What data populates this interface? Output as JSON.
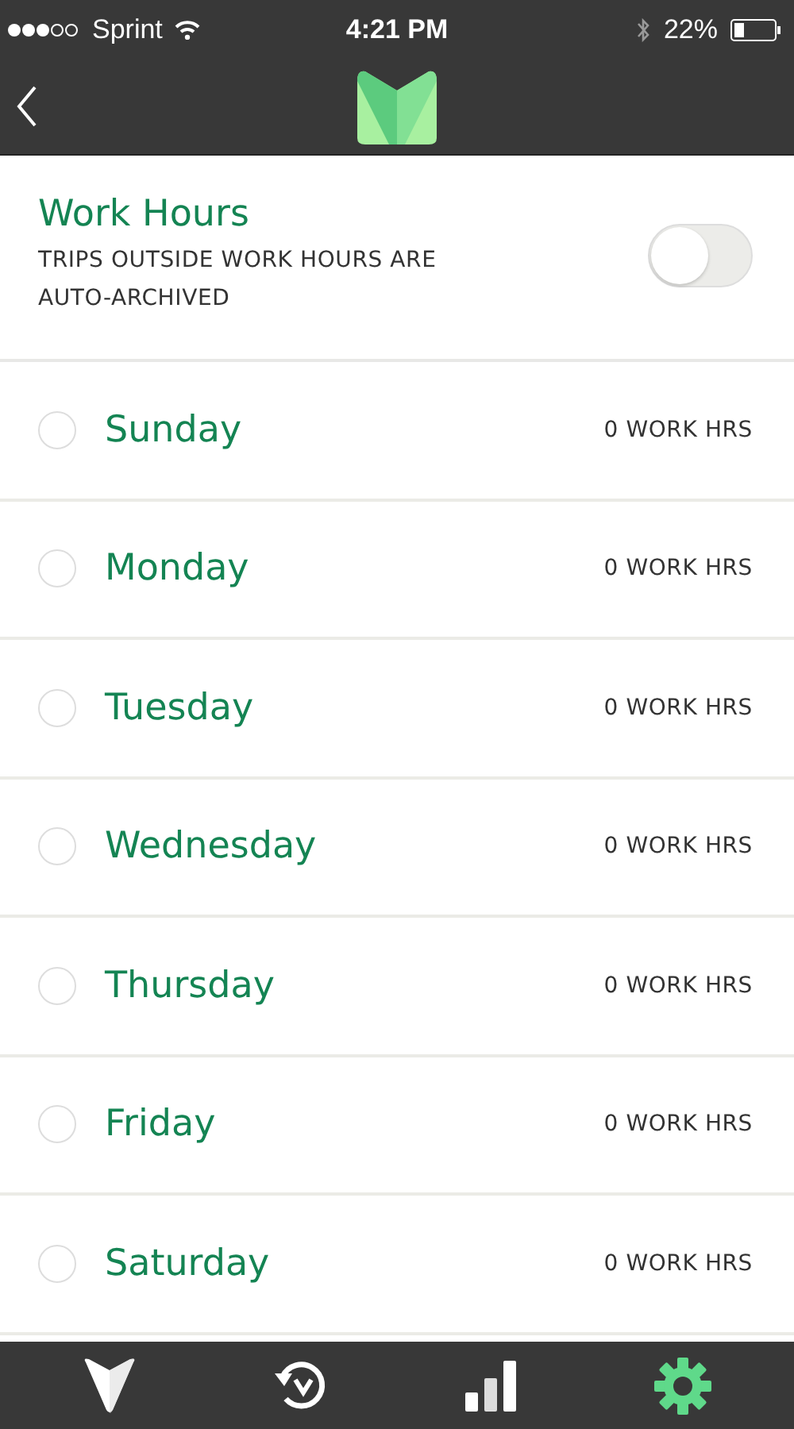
{
  "status_bar": {
    "carrier": "Sprint",
    "time": "4:21 PM",
    "battery": "22%"
  },
  "work_hours": {
    "title": "Work Hours",
    "subtitle": "TRIPS OUTSIDE WORK HOURS ARE AUTO-ARCHIVED",
    "on": false
  },
  "days": [
    {
      "name": "Sunday",
      "hours": "0 WORK HRS",
      "selected": false
    },
    {
      "name": "Monday",
      "hours": "0 WORK HRS",
      "selected": false
    },
    {
      "name": "Tuesday",
      "hours": "0 WORK HRS",
      "selected": false
    },
    {
      "name": "Wednesday",
      "hours": "0 WORK HRS",
      "selected": false
    },
    {
      "name": "Thursday",
      "hours": "0 WORK HRS",
      "selected": false
    },
    {
      "name": "Friday",
      "hours": "0 WORK HRS",
      "selected": false
    },
    {
      "name": "Saturday",
      "hours": "0 WORK HRS",
      "selected": false
    }
  ],
  "tab_bar": [
    {
      "kind": "drives",
      "selected": false
    },
    {
      "kind": "history",
      "selected": false
    },
    {
      "kind": "reports",
      "selected": false
    },
    {
      "kind": "settings",
      "selected": true
    }
  ]
}
